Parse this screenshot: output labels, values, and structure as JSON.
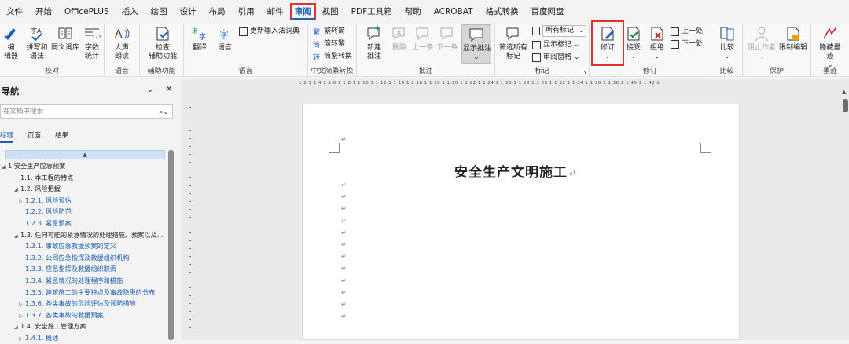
{
  "menu": [
    "文件",
    "开始",
    "OfficePLUS",
    "插入",
    "绘图",
    "设计",
    "布局",
    "引用",
    "邮件",
    "审阅",
    "视图",
    "PDF工具箱",
    "帮助",
    "ACROBAT",
    "格式转换",
    "百度网盘"
  ],
  "ribbon": {
    "proofing": {
      "label": "校对",
      "edit": "编\n辑器",
      "spell": "拼写和\n语法",
      "thesaurus": "同义词库",
      "wordcount": "字数\n统计"
    },
    "speech": {
      "label": "语音",
      "readaloud": "大声\n朗读"
    },
    "accessibility": {
      "label": "辅助功能",
      "check": "检查\n辅助功能"
    },
    "language": {
      "label": "语言",
      "translate": "翻译",
      "lang": "语言",
      "ime": "更新输入法词典"
    },
    "chinese": {
      "label": "中文简繁转换",
      "t2s": "繁转简",
      "s2t": "简转繁",
      "convert": "简繁转换"
    },
    "comments": {
      "label": "批注",
      "new": "新建\n批注",
      "delete": "删除",
      "prev": "上一条",
      "next": "下一条",
      "show": "显示批注"
    },
    "tracking": {
      "label": "标记",
      "filter": "筛选所有\n标记",
      "all_markup": "所有标记",
      "show_markup": "显示标记",
      "pane": "审阅窗格"
    },
    "changes": {
      "label": "修订",
      "track": "修订",
      "accept": "接受",
      "reject": "拒绝",
      "prev": "上一处",
      "next": "下一处"
    },
    "compare": {
      "label": "比较",
      "btn": "比较"
    },
    "protect": {
      "label": "保护",
      "block": "阻止作者",
      "restrict": "限制编辑"
    },
    "ink": {
      "label": "墨迹",
      "hide": "隐藏墨\n迹"
    }
  },
  "nav": {
    "title": "导航",
    "search_placeholder": "在文档中搜索",
    "tabs": [
      "标题",
      "页面",
      "结果"
    ],
    "items": [
      {
        "text": "1 安全生产应急预案",
        "lvl": 0,
        "car": "◢"
      },
      {
        "text": "1.1. 本工程的特点",
        "lvl": 1,
        "car": ""
      },
      {
        "text": "1.2. 风险把握",
        "lvl": 1,
        "car": "◢"
      },
      {
        "text": "1.2.1. 风险预估",
        "lvl": 2,
        "car": "▷"
      },
      {
        "text": "1.2.2. 风险防范",
        "lvl": 2,
        "car": ""
      },
      {
        "text": "1.2.3. 紧急预案",
        "lvl": 2,
        "car": ""
      },
      {
        "text": "1.3. 任何可能的紧急情况的处理措施、预案以及...",
        "lvl": 1,
        "car": "◢"
      },
      {
        "text": "1.3.1. 事故应急救援预案的定义",
        "lvl": 2,
        "car": ""
      },
      {
        "text": "1.3.2. 公司应急指挥及救援组织机构",
        "lvl": 2,
        "car": ""
      },
      {
        "text": "1.3.3. 应急指挥及救援组织职责",
        "lvl": 2,
        "car": ""
      },
      {
        "text": "1.3.4. 紧急情况的处理程序和措施",
        "lvl": 2,
        "car": ""
      },
      {
        "text": "1.3.5. 建筑施工的主要特点及事故隐患的分布",
        "lvl": 2,
        "car": ""
      },
      {
        "text": "1.3.6. 各类事故的危险评估及预防措施",
        "lvl": 2,
        "car": "▷"
      },
      {
        "text": "1.3.7. 各类事故的救援预案",
        "lvl": 2,
        "car": "▷"
      },
      {
        "text": "1.4. 安全施工管理方案",
        "lvl": 1,
        "car": "◢"
      },
      {
        "text": "1.4.1. 概述",
        "lvl": 2,
        "car": "▷"
      }
    ]
  },
  "ruler": "1 2 1  1 4 1  1 6 1  1 8 1  1 10 1  1 12 1  1 14 1  1 16 1  1 18 1  1 20 1  1 22 1  1 24 1  1 26 1  1 28 1  1 30 1  1 32 1  1 34 1  1 36 1  1 38 1  1 40 1  1 42 1",
  "document": {
    "title": "安全生产文明施工",
    "pilcrow": "↵"
  }
}
